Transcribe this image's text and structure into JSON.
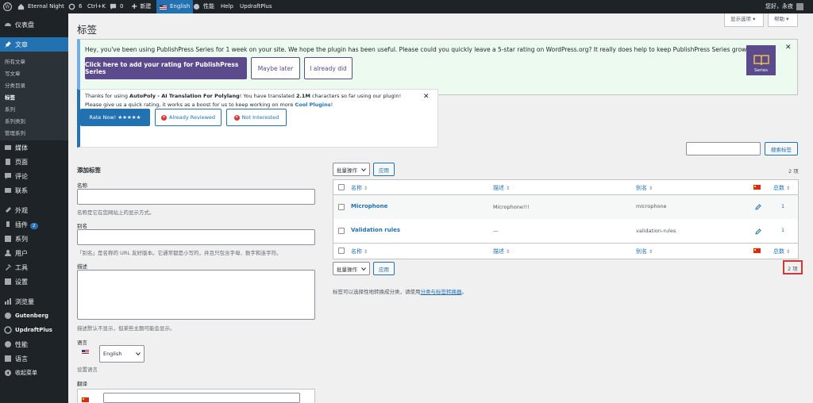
{
  "adminbar": {
    "site_name": "Eternal Night",
    "updates_count": "6",
    "shortcut": "Ctrl+K",
    "comments_count": "0",
    "new_label": "新建",
    "language_label": "English",
    "performance_label": "性能",
    "help_label": "Help",
    "updraft_label": "UpdraftPlus",
    "greeting": "您好，永夜"
  },
  "sidebar": {
    "dashboard": "仪表盘",
    "posts": "文章",
    "posts_sub": [
      "所有文章",
      "写文章",
      "分类目录",
      "标签",
      "系列",
      "系列类别",
      "管理系列"
    ],
    "media": "媒体",
    "pages": "页面",
    "comments": "评论",
    "contact": "联系",
    "appearance": "外观",
    "plugins": "插件",
    "plugins_badge": "2",
    "series": "系列",
    "users": "用户",
    "tools": "工具",
    "settings": "设置",
    "views": "浏览量",
    "gutenberg": "Gutenberg",
    "updraftplus": "UpdraftPlus",
    "performance": "性能",
    "languages": "语言",
    "collapse": "收起菜单"
  },
  "screen_options": "显示选项 ▾",
  "help": "帮助 ▾",
  "page_title": "标签",
  "notice_series": {
    "text": "Hey, you've been using PublishPress Series for 1 week on your site. We hope the plugin has been useful. Please could you quickly leave a 5-star rating on WordPress.org? It really does help to keep PublishPress Series growing.",
    "rate_button": "Click here to add your rating for PublishPress Series",
    "later_button": "Maybe later",
    "did_button": "I already did",
    "logo_label": "Series",
    "accent": "#5b4a8c"
  },
  "notice_autopoly": {
    "line1_pre": "Thanks for using ",
    "line1_plugin": "AutoPoly - AI Translation For Polylang",
    "line1_mid": "! You have translated ",
    "line1_amount": "2.1M",
    "line1_post": " characters so far using our plugin!",
    "line2_pre": "Please give us a quick rating, it works as a boost for us to keep working on more ",
    "line2_link": "Cool Plugins",
    "line2_post": "!",
    "rate_button": "Rate Now! ★★★★★",
    "reviewed_button": "Already Reviewed",
    "not_interested_button": "Not Interested"
  },
  "search": {
    "value": "",
    "button": "搜索标签"
  },
  "add_tag": {
    "heading": "添加标签",
    "name_label": "名称",
    "name_hint": "名称是它在您网站上的显示方式。",
    "slug_label": "别名",
    "slug_hint": "「别名」是名称的 URL 友好版本。它通常都是小写的，并且只包含字母、数字和连字符。",
    "desc_label": "描述",
    "desc_hint": "描述默认不显示，但某些主题可能会显示。",
    "lang_label": "语言",
    "lang_value": "English",
    "lang_hint": "设置语言",
    "trans_label": "翻译"
  },
  "list": {
    "bulk_label": "批量操作",
    "apply_label": "应用",
    "count_top": "2 项",
    "count_bottom": "2 项",
    "columns": [
      "名称",
      "描述",
      "别名",
      "总数"
    ],
    "rows": [
      {
        "name": "Microphone",
        "description": "Microphone!!!",
        "slug": "microphone",
        "count": "1"
      },
      {
        "name": "Validation rules",
        "description": "—",
        "slug": "validation-rules",
        "count": "1"
      }
    ],
    "footnote_pre": "标签可以选择性地转换成分类，请使用",
    "footnote_link": "分类与标签转换器",
    "footnote_post": "。"
  }
}
